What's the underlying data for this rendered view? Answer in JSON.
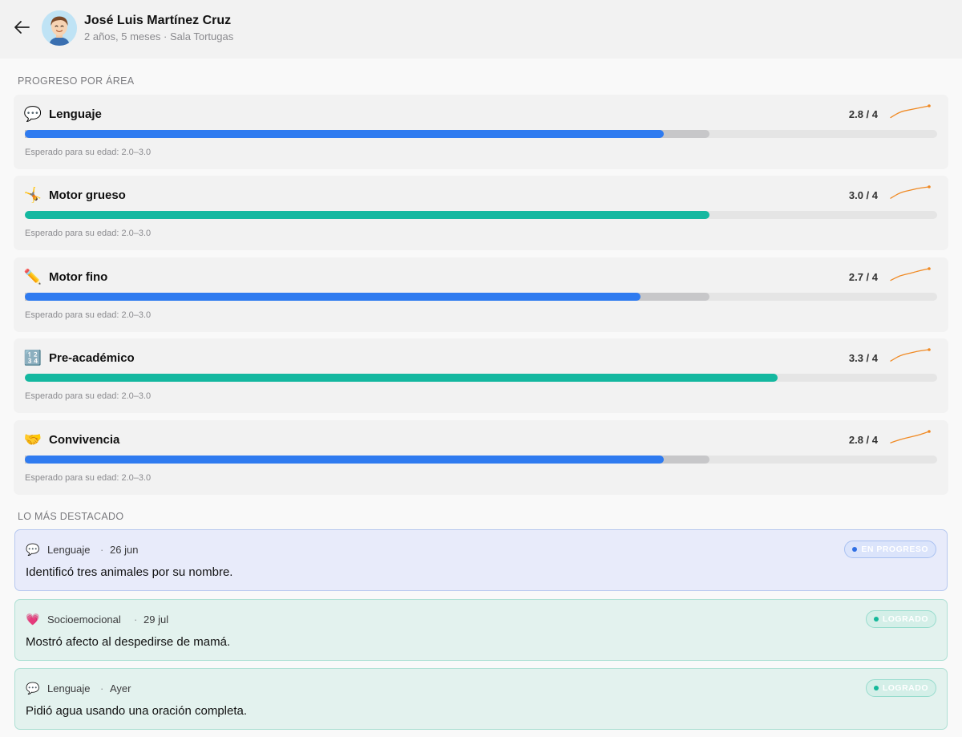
{
  "header": {
    "name": "José Luis Martínez Cruz",
    "subtitle": "2 años, 5 meses · Sala Tortugas",
    "back_icon": "arrow-left-icon",
    "avatar_icon": "child-avatar"
  },
  "progress": {
    "title": "PROGRESO POR ÁREA",
    "max": 4,
    "expected_range": [
      2.0,
      3.0
    ],
    "areas": [
      {
        "emoji": "💬",
        "icon": "speech-bubble-icon",
        "name": "Lenguaje",
        "score_label": "2.8 / 4",
        "score": 2.8,
        "bar_color": "#2f7bf0",
        "trend": [
          2.2,
          2.5,
          2.6,
          2.7,
          2.8
        ],
        "expected": "Esperado para su edad: 2.0–3.0"
      },
      {
        "emoji": "🤸",
        "icon": "gymnast-icon",
        "name": "Motor grueso",
        "score_label": "3.0 / 4",
        "score": 3.0,
        "bar_color": "#14b8a0",
        "trend": [
          2.5,
          2.75,
          2.85,
          2.95,
          3.0
        ],
        "expected": "Esperado para su edad: 2.0–3.0"
      },
      {
        "emoji": "✏️",
        "icon": "pencil-icon",
        "name": "Motor fino",
        "score_label": "2.7 / 4",
        "score": 2.7,
        "bar_color": "#2f7bf0",
        "trend": [
          2.1,
          2.35,
          2.45,
          2.6,
          2.7
        ],
        "expected": "Esperado para su edad: 2.0–3.0"
      },
      {
        "emoji": "🔢",
        "icon": "numbers-icon",
        "name": "Pre-académico",
        "score_label": "3.3 / 4",
        "score": 3.3,
        "bar_color": "#14b8a0",
        "trend": [
          2.8,
          3.05,
          3.15,
          3.25,
          3.3
        ],
        "expected": "Esperado para su edad: 2.0–3.0"
      },
      {
        "emoji": "🤝",
        "icon": "handshake-icon",
        "name": "Convivencia",
        "score_label": "2.8 / 4",
        "score": 2.8,
        "bar_color": "#2f7bf0",
        "trend": [
          2.3,
          2.45,
          2.55,
          2.65,
          2.8
        ],
        "expected": "Esperado para su edad: 2.0–3.0"
      }
    ]
  },
  "highlights": {
    "title": "LO MÁS DESTACADO",
    "items": [
      {
        "emoji": "💬",
        "icon": "speech-bubble-icon",
        "area": "Lenguaje",
        "sep": "·",
        "date": "26 jun",
        "badge": "EN PROGRESO",
        "status": "blue",
        "text": "Identificó tres animales por su nombre."
      },
      {
        "emoji": "💗",
        "icon": "heart-icon",
        "area": "Socioemocional",
        "sep": "·",
        "date": "29 jul",
        "badge": "LOGRADO",
        "status": "green",
        "text": "Mostró afecto al despedirse de mamá."
      },
      {
        "emoji": "💬",
        "icon": "speech-bubble-icon",
        "area": "Lenguaje",
        "sep": "·",
        "date": "Ayer",
        "badge": "LOGRADO",
        "status": "green",
        "text": "Pidió agua usando una oración completa."
      }
    ]
  },
  "colors": {
    "trend_line": "#f08a24",
    "blue_fill": "#2f7bf0",
    "teal_fill": "#14b8a0",
    "expected_band": "#c7c7c9"
  }
}
